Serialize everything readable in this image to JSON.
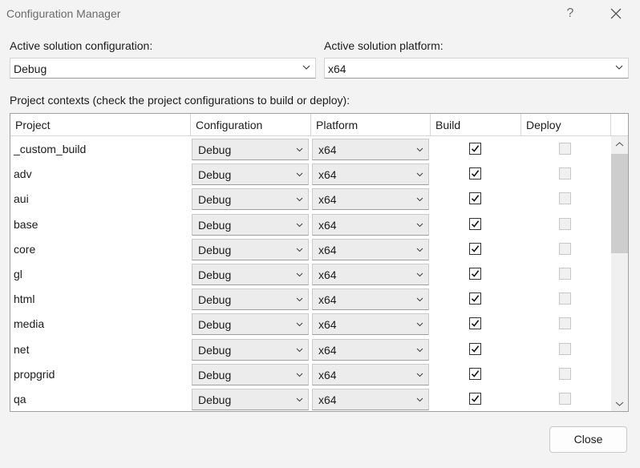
{
  "window": {
    "title": "Configuration Manager",
    "help_glyph": "?"
  },
  "solution": {
    "config_label": "Active solution configuration:",
    "config_value": "Debug",
    "platform_label": "Active solution platform:",
    "platform_value": "x64"
  },
  "contexts_label": "Project contexts (check the project configurations to build or deploy):",
  "columns": [
    "Project",
    "Configuration",
    "Platform",
    "Build",
    "Deploy"
  ],
  "rows": [
    {
      "project": "_custom_build",
      "configuration": "Debug",
      "platform": "x64",
      "build": true,
      "deploy": false
    },
    {
      "project": "adv",
      "configuration": "Debug",
      "platform": "x64",
      "build": true,
      "deploy": false
    },
    {
      "project": "aui",
      "configuration": "Debug",
      "platform": "x64",
      "build": true,
      "deploy": false
    },
    {
      "project": "base",
      "configuration": "Debug",
      "platform": "x64",
      "build": true,
      "deploy": false
    },
    {
      "project": "core",
      "configuration": "Debug",
      "platform": "x64",
      "build": true,
      "deploy": false
    },
    {
      "project": "gl",
      "configuration": "Debug",
      "platform": "x64",
      "build": true,
      "deploy": false
    },
    {
      "project": "html",
      "configuration": "Debug",
      "platform": "x64",
      "build": true,
      "deploy": false
    },
    {
      "project": "media",
      "configuration": "Debug",
      "platform": "x64",
      "build": true,
      "deploy": false
    },
    {
      "project": "net",
      "configuration": "Debug",
      "platform": "x64",
      "build": true,
      "deploy": false
    },
    {
      "project": "propgrid",
      "configuration": "Debug",
      "platform": "x64",
      "build": true,
      "deploy": false
    },
    {
      "project": "qa",
      "configuration": "Debug",
      "platform": "x64",
      "build": true,
      "deploy": false
    }
  ],
  "buttons": {
    "close": "Close"
  }
}
